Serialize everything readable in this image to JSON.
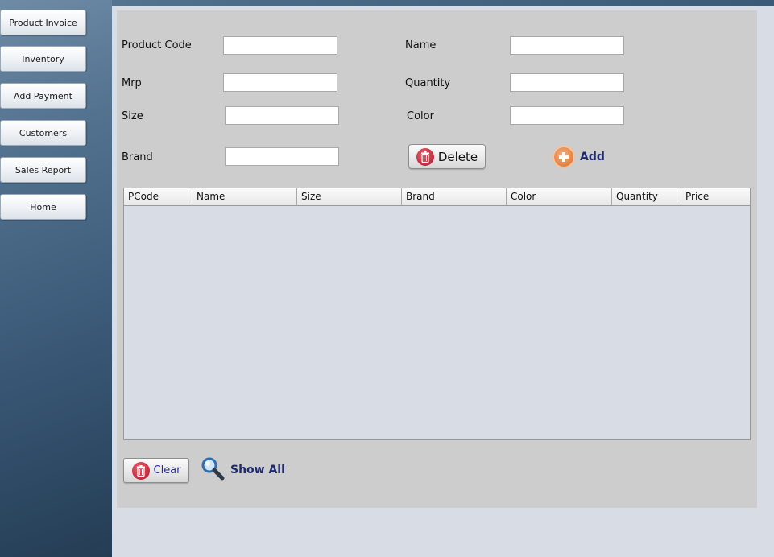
{
  "sidebar": {
    "items": [
      {
        "label": "Product Invoice"
      },
      {
        "label": "Inventory"
      },
      {
        "label": "Add Payment"
      },
      {
        "label": "Customers"
      },
      {
        "label": "Sales Report"
      },
      {
        "label": "Home"
      }
    ]
  },
  "form": {
    "product_code": {
      "label": "Product Code",
      "value": ""
    },
    "name": {
      "label": "Name",
      "value": ""
    },
    "mrp": {
      "label": "Mrp",
      "value": ""
    },
    "quantity": {
      "label": "Quantity",
      "value": ""
    },
    "size": {
      "label": "Size",
      "value": ""
    },
    "color": {
      "label": "Color",
      "value": ""
    },
    "brand": {
      "label": "Brand",
      "value": ""
    }
  },
  "actions": {
    "delete_label": "Delete",
    "add_label": "Add",
    "clear_label": "Clear",
    "show_all_label": "Show All"
  },
  "table": {
    "columns": [
      "PCode",
      "Name",
      "Size",
      "Brand",
      "Color",
      "Quantity",
      "Price"
    ],
    "rows": []
  },
  "icons": {
    "delete": "trash-icon",
    "add": "plus-circle-icon",
    "clear": "trash-icon",
    "show_all": "magnifier-icon"
  },
  "colors": {
    "accent_text": "#1f2a6e",
    "trash_red": "#c22a3d",
    "add_orange": "#e07a3a"
  }
}
